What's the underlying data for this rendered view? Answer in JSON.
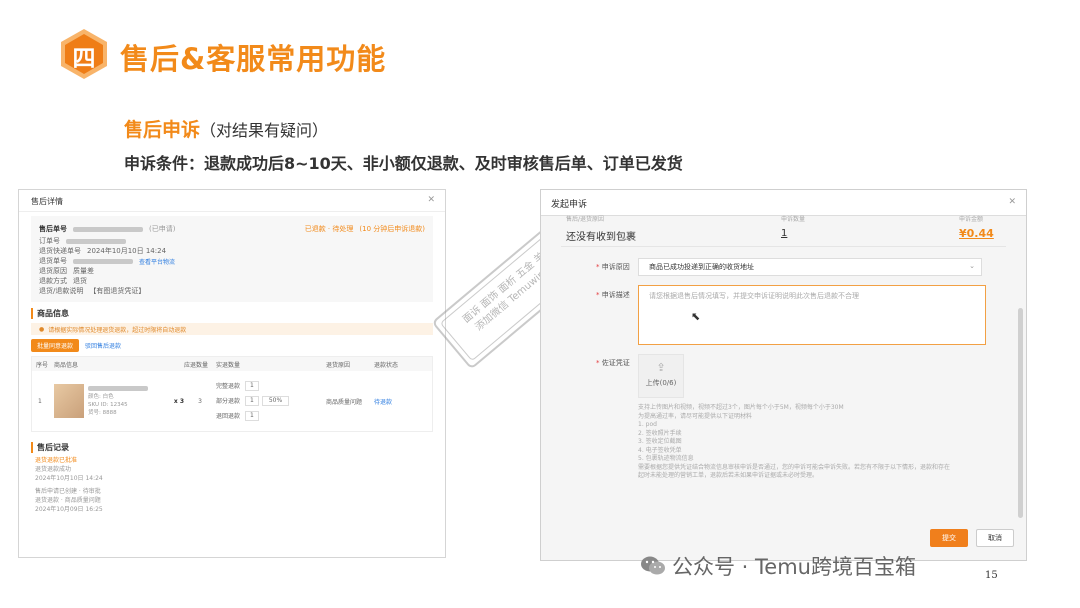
{
  "slide": {
    "number_badge": "四",
    "title": "售后&客服常用功能",
    "sub_title": "售后申诉",
    "sub_note": "（对结果有疑问）",
    "conditions": "申诉条件：退款成功后8~10天、非小额仅退款、及时审核售后单、订单已发货",
    "page_number": "15"
  },
  "watermark": {
    "text": "公众号 · Temu跨境百宝箱",
    "stamp_line1": "面诉 面饰 面析 五金 羊批",
    "stamp_line2": "添加微信 Temuwinner"
  },
  "left_panel": {
    "title": "售后详情",
    "order_label": "售后单号",
    "order_status": "(已申请)",
    "status_right": "已退款 · 待处理",
    "status_link": "(10 分钟后申诉退款)",
    "info_rows": [
      {
        "label": "订单号"
      },
      {
        "label": "退货快递单号",
        "value": "2024年10月10日 14:24"
      },
      {
        "label": "退货单号",
        "link": "查看平台物流"
      },
      {
        "label": "退货原因",
        "value": "质量差"
      },
      {
        "label": "退款方式",
        "value": "退货"
      },
      {
        "label": "退货/退款说明",
        "value": "【有图退货凭证】"
      }
    ],
    "goods_section": "商品信息",
    "warning": "请根据实际情况处理退货退款，超过时限将自动退款",
    "btn_refund": "批量同意退款",
    "btn_reject": "驳回售后退款",
    "columns": [
      "序号",
      "商品信息",
      "应退数量",
      "实退数量",
      "退货原因",
      "退款状态"
    ],
    "row": {
      "index": "1",
      "qty_mark": "x 3",
      "qty_applied": "3",
      "spec_lines": [
        "颜色: 白色",
        "SKU ID: 12345",
        "货号: 8888"
      ],
      "actions": [
        {
          "label": "完整退款",
          "qty": "1"
        },
        {
          "label": "部分退款",
          "qty": "1",
          "pct": "50%"
        },
        {
          "label": "退回退款",
          "qty": "1"
        }
      ],
      "reason": "商品质量问题",
      "status": "待退款"
    },
    "records_section": "售后记录",
    "records": [
      {
        "title": "退货退款已批准",
        "sub": "退货退款成功",
        "time": "2024年10月10日 14:24"
      },
      {
        "title": "售后申请已创建 · 待审批",
        "sub": "退货退款 · 商品质量问题",
        "time": "2024年10月09日 16:25"
      }
    ]
  },
  "right_panel": {
    "title": "发起申诉",
    "col_item": "售后/退货原因",
    "col_qty": "申诉数量",
    "col_amount": "申诉金额",
    "item_name": "还没有收到包裹",
    "qty": "1",
    "amount": "¥0.44",
    "reason_label": "申诉原因",
    "reason_value": "商品已成功投递到正确的收货地址",
    "desc_label": "申诉描述",
    "desc_placeholder": "请您根据退售后情况填写，并提交申诉证明说明此次售后退款不合理",
    "proof_label": "佐证凭证",
    "upload_label": "上传(0/6)",
    "hints": [
      "支持上传图片和视频，视频不超过3个，图片每个小于5M，视频每个小于30M",
      "为提高通过率，请尽可能提供以下证明材料",
      "1. pod",
      "2. 签收照片手续",
      "3. 签收定位截图",
      "4. 电子签收凭单",
      "5. 包裹轨迹物流信息",
      "需要根据您提供凭证结合物流信息审核申诉是否通过，您的申诉可能会申诉失败。若您有不限于以下情形，退款和存在",
      "起时未能处理的营销工单，退款后若未如果申诉证据或未必时受理。"
    ],
    "submit": "提交",
    "cancel": "取消"
  }
}
